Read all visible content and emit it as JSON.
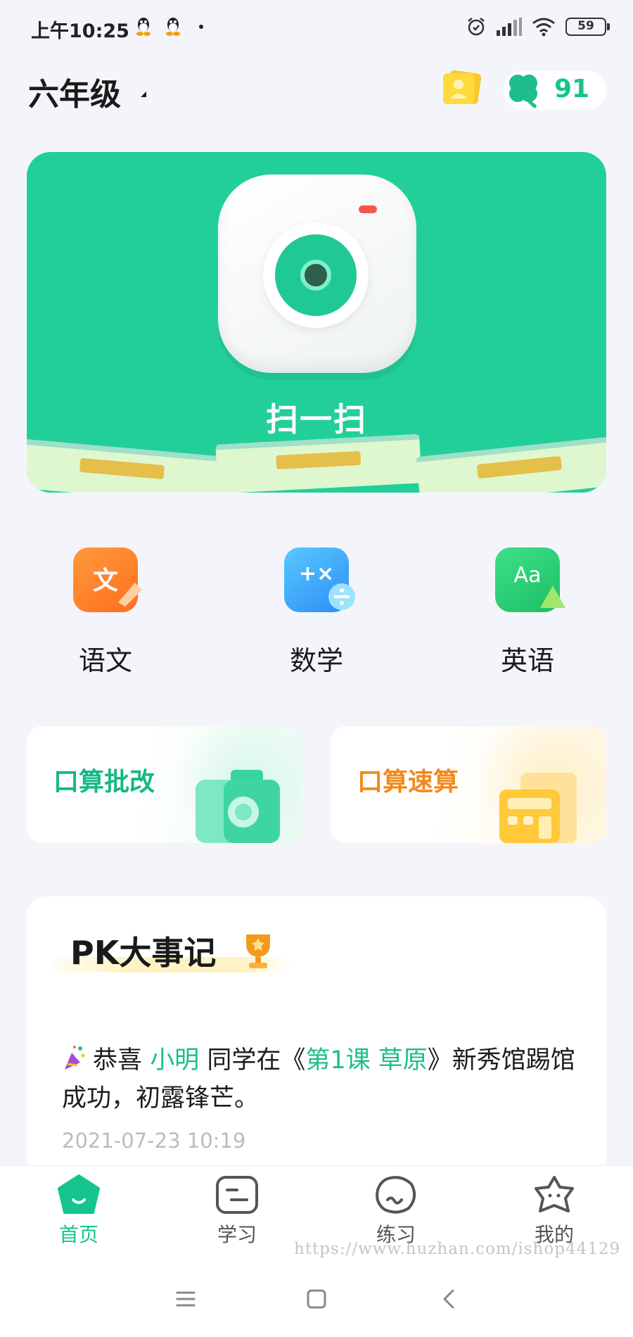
{
  "status_bar": {
    "time": "上午10:25",
    "battery": "59"
  },
  "header": {
    "grade": "六年级",
    "clover_count": "91"
  },
  "scan": {
    "label": "扫一扫"
  },
  "subjects": [
    {
      "label": "语文",
      "icon_text": "文"
    },
    {
      "label": "数学",
      "icon_text": "+×"
    },
    {
      "label": "英语",
      "icon_text": "Aa"
    }
  ],
  "quick": {
    "oral_check": "口算批改",
    "oral_speed": "口算速算"
  },
  "pk": {
    "title": "PK大事记",
    "msg_prefix": "恭喜",
    "msg_name": "小明",
    "msg_mid": "同学在《",
    "msg_lesson": "第1课 草原",
    "msg_suffix": "》新秀馆踢馆成功，初露锋芒。",
    "time": "2021-07-23 10:19"
  },
  "tabs": [
    {
      "label": "首页",
      "active": true
    },
    {
      "label": "学习",
      "active": false
    },
    {
      "label": "练习",
      "active": false
    },
    {
      "label": "我的",
      "active": false
    }
  ],
  "watermark": "https://www.huzhan.com/ishop44129",
  "colors": {
    "brand_green": "#22cf99",
    "accent_green": "#15c48e",
    "orange": "#f08a1e",
    "background": "#f4f5fa"
  }
}
